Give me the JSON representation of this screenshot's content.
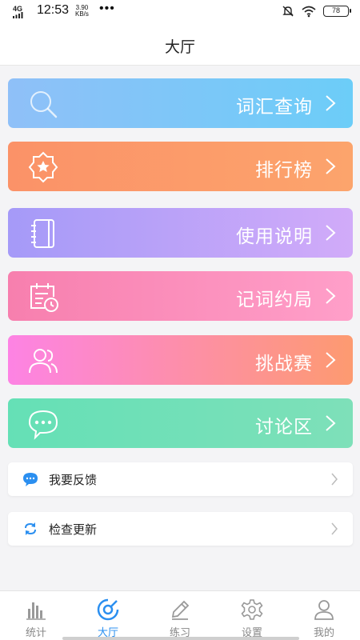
{
  "status_bar": {
    "network": "4G",
    "time": "12:53",
    "speed_value": "3.90",
    "speed_unit": "KB/s",
    "more": "•••",
    "battery": "78"
  },
  "header": {
    "title": "大厅"
  },
  "menu_cards": [
    {
      "label": "词汇查询",
      "icon": "search-icon"
    },
    {
      "label": "排行榜",
      "icon": "badge-star-icon"
    },
    {
      "label": "使用说明",
      "icon": "notebook-icon"
    },
    {
      "label": "记词约局",
      "icon": "calendar-clock-icon"
    },
    {
      "label": "挑战赛",
      "icon": "users-icon"
    },
    {
      "label": "讨论区",
      "icon": "chat-bubble-icon"
    }
  ],
  "list_rows": [
    {
      "label": "我要反馈",
      "icon": "feedback-icon"
    },
    {
      "label": "检查更新",
      "icon": "refresh-icon"
    }
  ],
  "tab_bar": {
    "tabs": [
      {
        "label": "统计",
        "icon": "bar-chart-icon"
      },
      {
        "label": "大厅",
        "icon": "hall-icon"
      },
      {
        "label": "练习",
        "icon": "pencil-icon"
      },
      {
        "label": "设置",
        "icon": "gear-icon"
      },
      {
        "label": "我的",
        "icon": "user-icon"
      }
    ],
    "active": "大厅"
  },
  "colors": {
    "accent": "#2b8ff0",
    "card_vocab": "#7cc6f8",
    "card_rank": "#fc9a6a",
    "card_guide": "#b8a2f9",
    "card_appointment": "#fb8dbb",
    "card_challenge": "#fd8eaa",
    "card_forum": "#70e0b7"
  }
}
